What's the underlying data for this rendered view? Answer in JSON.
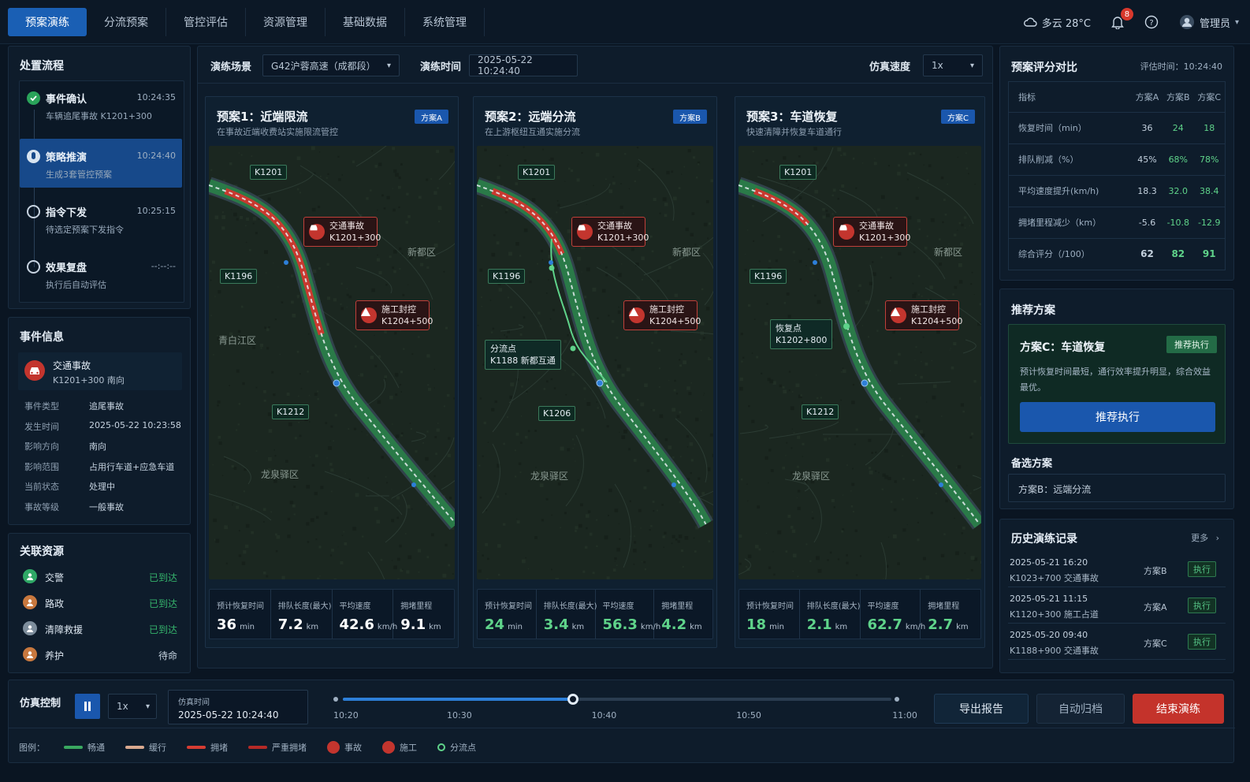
{
  "nav": {
    "items": [
      "预案演练",
      "分流预案",
      "管控评估",
      "资源管理",
      "基础数据",
      "系统管理"
    ],
    "active": 0
  },
  "topbar": {
    "weather": "多云 28°C",
    "notifications": "8",
    "user": "管理员"
  },
  "process": {
    "title": "处置流程",
    "steps": [
      {
        "title": "事件确认",
        "time": "10:24:35",
        "sub": "车辆追尾事故 K1201+300",
        "state": "done"
      },
      {
        "title": "策略推演",
        "time": "10:24:40",
        "sub": "生成3套管控预案",
        "state": "active"
      },
      {
        "title": "指令下发",
        "time": "10:25:15",
        "sub": "待选定预案下发指令",
        "state": "pending"
      },
      {
        "title": "效果复盘",
        "time": "--:--:--",
        "sub": "执行后自动评估",
        "state": "pending"
      }
    ]
  },
  "event": {
    "title": "事件信息",
    "name": "交通事故",
    "location": "K1201+300 南向",
    "fields": [
      {
        "k": "事件类型",
        "v": "追尾事故"
      },
      {
        "k": "发生时间",
        "v": "2025-05-22 10:23:58"
      },
      {
        "k": "影响方向",
        "v": "南向"
      },
      {
        "k": "影响范围",
        "v": "占用行车道+应急车道"
      },
      {
        "k": "当前状态",
        "v": "处理中"
      },
      {
        "k": "事故等级",
        "v": "一般事故"
      }
    ]
  },
  "resources": {
    "title": "关联资源",
    "items": [
      {
        "name": "交警",
        "status": "已到达",
        "color": "#2fa866"
      },
      {
        "name": "路政",
        "status": "已到达",
        "color": "#c8783e"
      },
      {
        "name": "清障救援",
        "status": "已到达",
        "color": "#7d8d9c"
      },
      {
        "name": "养护",
        "status": "待命",
        "color": "#c8783e"
      }
    ]
  },
  "toolbar": {
    "scene_label": "演练场景",
    "scene_value": "G42沪蓉高速（成都段）",
    "time_label": "演练时间",
    "time_value": "2025-05-22  10:24:40",
    "speed_label": "仿真速度",
    "speed_value": "1x"
  },
  "plans": [
    {
      "title": "预案1：近端限流",
      "sub": "在事故近端收费站实施限流管控",
      "tag": "方案A",
      "labels": [
        {
          "t": "K1201"
        },
        {
          "t": "K1196"
        },
        {
          "t": "K1212"
        }
      ],
      "special": null,
      "stats": [
        {
          "l": "预计恢复时间",
          "v": "36",
          "u": "min"
        },
        {
          "l": "排队长度(最大)",
          "v": "7.2",
          "u": "km"
        },
        {
          "l": "平均速度",
          "v": "42.6",
          "u": "km/h"
        },
        {
          "l": "拥堵里程",
          "v": "9.1",
          "u": "km"
        }
      ],
      "accent": "#ffffff",
      "districts": [
        "新都区",
        "青白江区",
        "龙泉驿区"
      ]
    },
    {
      "title": "预案2：远端分流",
      "sub": "在上游枢纽互通实施分流",
      "tag": "方案B",
      "labels": [
        {
          "t": "K1201"
        },
        {
          "t": "K1196"
        },
        {
          "t": "K1206"
        }
      ],
      "special": {
        "l1": "分流点",
        "l2": "K1188 新都互通"
      },
      "stats": [
        {
          "l": "预计恢复时间",
          "v": "24",
          "u": "min"
        },
        {
          "l": "排队长度(最大)",
          "v": "3.4",
          "u": "km"
        },
        {
          "l": "平均速度",
          "v": "56.3",
          "u": "km/h"
        },
        {
          "l": "拥堵里程",
          "v": "4.2",
          "u": "km"
        }
      ],
      "accent": "#5fd38a",
      "districts": [
        "新都区",
        "龙泉驿区"
      ]
    },
    {
      "title": "预案3：车道恢复",
      "sub": "快速清障并恢复车道通行",
      "tag": "方案C",
      "labels": [
        {
          "t": "K1201"
        },
        {
          "t": "K1196"
        },
        {
          "t": "K1212"
        }
      ],
      "special": {
        "l1": "恢复点",
        "l2": "K1202+800"
      },
      "stats": [
        {
          "l": "预计恢复时间",
          "v": "18",
          "u": "min"
        },
        {
          "l": "排队长度(最大)",
          "v": "2.1",
          "u": "km"
        },
        {
          "l": "平均速度",
          "v": "62.7",
          "u": "km/h"
        },
        {
          "l": "拥堵里程",
          "v": "2.7",
          "u": "km"
        }
      ],
      "accent": "#5fd38a",
      "districts": [
        "新都区",
        "龙泉驿区"
      ]
    }
  ],
  "map_events": {
    "accident": {
      "l1": "交通事故",
      "l2": "K1201+300"
    },
    "construction": {
      "l1": "施工封控",
      "l2": "K1204+500"
    }
  },
  "compare": {
    "title": "预案评分对比",
    "eval_time": "评估时间：10:24:40",
    "header": [
      "指标",
      "方案A",
      "方案B",
      "方案C"
    ],
    "rows": [
      [
        "恢复时间（min）",
        "36",
        "24",
        "18"
      ],
      [
        "排队削减（%）",
        "45%",
        "68%",
        "78%"
      ],
      [
        "平均速度提升(km/h)",
        "18.3",
        "32.0",
        "38.4"
      ],
      [
        "拥堵里程减少（km）",
        "-5.6",
        "-10.8",
        "-12.9"
      ],
      [
        "综合评分（/100）",
        "62",
        "82",
        "91"
      ]
    ]
  },
  "recommend": {
    "title": "推荐方案",
    "name": "方案C：车道恢复",
    "badge": "推荐执行",
    "desc": "预计恢复时间最短，通行效率提升明显，综合效益最优。",
    "button": "推荐执行",
    "alt_title": "备选方案",
    "alt": "方案B：远端分流"
  },
  "history": {
    "title": "历史演练记录",
    "more": "更多",
    "items": [
      {
        "time": "2025-05-21  16:20",
        "desc": "K1023+700 交通事故",
        "plan": "方案B",
        "tag": "执行"
      },
      {
        "time": "2025-05-21  11:15",
        "desc": "K1120+300 施工占道",
        "plan": "方案A",
        "tag": "执行"
      },
      {
        "time": "2025-05-20  09:40",
        "desc": "K1188+900 交通事故",
        "plan": "方案C",
        "tag": "执行"
      }
    ]
  },
  "sim": {
    "title": "仿真控制",
    "speed": "1x",
    "time_label": "仿真时间",
    "time_value": "2025-05-22  10:24:40",
    "ticks": [
      "10:20",
      "10:30",
      "10:40",
      "10:50",
      "11:00"
    ],
    "progress": 0.42
  },
  "actions": {
    "export": "导出报告",
    "archive": "自动归档",
    "end": "结束演练"
  },
  "legend": {
    "title": "图例：",
    "items": [
      {
        "name": "畅通",
        "color": "#3aa860",
        "kind": "line"
      },
      {
        "name": "缓行",
        "color": "#d9a98f",
        "kind": "line"
      },
      {
        "name": "拥堵",
        "color": "#d63c32",
        "kind": "line"
      },
      {
        "name": "严重拥堵",
        "color": "#b52a26",
        "kind": "line"
      },
      {
        "name": "事故",
        "color": "#c3352e",
        "kind": "icon"
      },
      {
        "name": "施工",
        "color": "#c3352e",
        "kind": "icon"
      },
      {
        "name": "分流点",
        "color": "#5fd38a",
        "kind": "dot"
      }
    ]
  }
}
